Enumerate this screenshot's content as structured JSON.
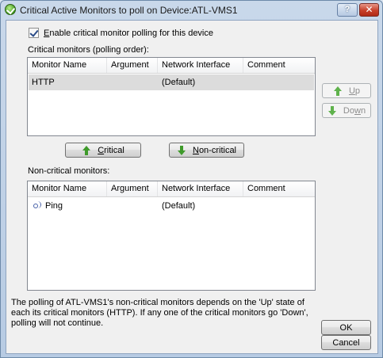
{
  "window": {
    "title": "Critical Active Monitors to poll on Device:ATL-VMS1",
    "help_label": "?",
    "close_label": "✕"
  },
  "enable_checkbox": {
    "checked": true,
    "label_underlined": "E",
    "label_rest": "nable critical monitor polling for this device"
  },
  "critical": {
    "section_label": "Critical monitors (polling order):",
    "columns": [
      "Monitor Name",
      "Argument",
      "Network Interface",
      "Comment"
    ],
    "rows": [
      {
        "monitor": "HTTP",
        "argument": "",
        "interface": "(Default)",
        "comment": "",
        "selected": true
      }
    ]
  },
  "side_buttons": {
    "up_underlined": "U",
    "up_rest": "p",
    "down_pre": "Do",
    "down_underlined": "w",
    "down_rest": "n"
  },
  "move_buttons": {
    "critical_underlined": "C",
    "critical_rest": "ritical",
    "noncritical_underlined": "N",
    "noncritical_rest": "on-critical"
  },
  "noncritical": {
    "section_label": "Non-critical monitors:",
    "columns": [
      "Monitor Name",
      "Argument",
      "Network Interface",
      "Comment"
    ],
    "rows": [
      {
        "icon": "ping-icon",
        "monitor": "Ping",
        "argument": "",
        "interface": "(Default)",
        "comment": ""
      }
    ]
  },
  "footer": {
    "text": "The polling of ATL-VMS1's non-critical monitors depends on the 'Up' state of each its critical monitors (HTTP). If any one of the critical monitors go 'Down', polling will not continue."
  },
  "dialog_buttons": {
    "ok_label": "OK",
    "cancel_label": "Cancel"
  }
}
